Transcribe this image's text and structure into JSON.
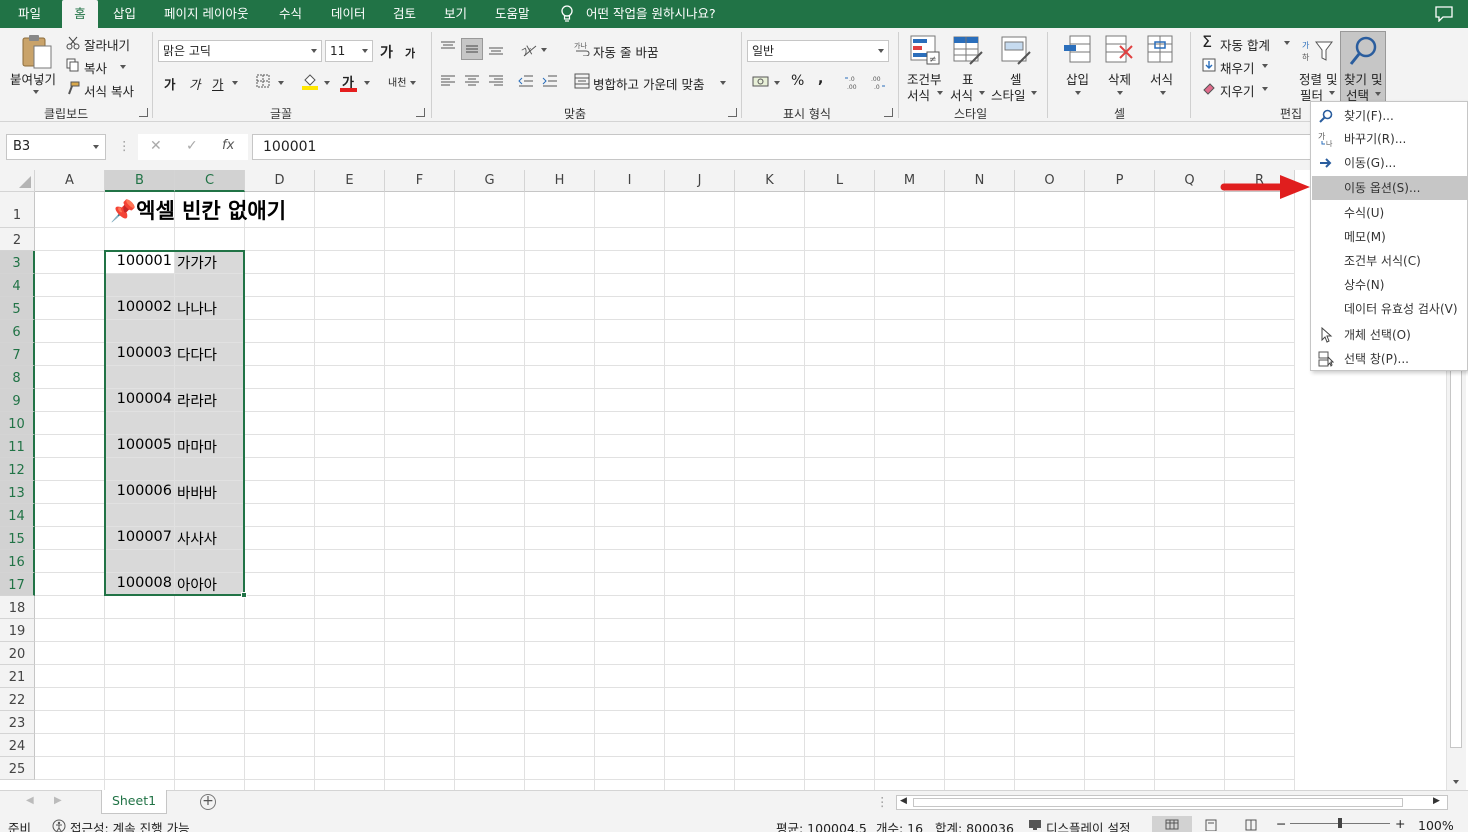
{
  "tabs": [
    "파일",
    "홈",
    "삽입",
    "페이지 레이아웃",
    "수식",
    "데이터",
    "검토",
    "보기",
    "도움말"
  ],
  "tell_me": "어떤 작업을 원하시나요?",
  "ribbon": {
    "clipboard": {
      "paste": "붙여넣기",
      "cut": "잘라내기",
      "copy": "복사",
      "format_painter": "서식 복사",
      "label": "클립보드"
    },
    "font": {
      "name": "맑은 고딕",
      "size": "11",
      "grow": "가",
      "shrink": "가",
      "bold": "가",
      "italic": "가",
      "underline": "가",
      "font_color": "가",
      "phonetic": "내천",
      "label": "글꼴"
    },
    "alignment": {
      "wrap": "자동 줄 바꿈",
      "merge": "병합하고 가운데 맞춤",
      "label": "맞춤"
    },
    "number": {
      "format": "일반",
      "percent": "%",
      "comma": ",",
      "inc": "←.0 .00",
      "dec": ".00 →.0",
      "label": "표시 형식"
    },
    "styles": {
      "conditional_1": "조건부",
      "conditional_2": "서식",
      "table_1": "표",
      "table_2": "서식",
      "cell_1": "셀",
      "cell_2": "스타일",
      "label": "스타일"
    },
    "cells": {
      "insert": "삽입",
      "delete": "삭제",
      "format": "서식",
      "label": "셀"
    },
    "editing": {
      "autosum": "자동 합계",
      "fill": "채우기",
      "clear": "지우기",
      "sort_1": "정렬 및",
      "sort_2": "필터",
      "find_1": "찾기 및",
      "find_2": "선택",
      "label": "편집"
    }
  },
  "formula_bar": {
    "name_box": "B3",
    "cancel": "✕",
    "enter": "✓",
    "fx": "fx",
    "value": "100001"
  },
  "columns": [
    "A",
    "B",
    "C",
    "D",
    "E",
    "F",
    "G",
    "H",
    "I",
    "J",
    "K",
    "L",
    "M",
    "N",
    "O",
    "P",
    "Q",
    "R"
  ],
  "rows": [
    "1",
    "2",
    "3",
    "4",
    "5",
    "6",
    "7",
    "8",
    "9",
    "10",
    "11",
    "12",
    "13",
    "14",
    "15",
    "16",
    "17",
    "18",
    "19",
    "20",
    "21",
    "22",
    "23",
    "24",
    "25"
  ],
  "sheet": {
    "title": "📌엑셀 빈칸 없애기",
    "data": [
      {
        "row": "3",
        "num": "100001",
        "text": "가가가"
      },
      {
        "row": "5",
        "num": "100002",
        "text": "나나나"
      },
      {
        "row": "7",
        "num": "100003",
        "text": "다다다"
      },
      {
        "row": "9",
        "num": "100004",
        "text": "라라라"
      },
      {
        "row": "11",
        "num": "100005",
        "text": "마마마"
      },
      {
        "row": "13",
        "num": "100006",
        "text": "바바바"
      },
      {
        "row": "15",
        "num": "100007",
        "text": "사사사"
      },
      {
        "row": "17",
        "num": "100008",
        "text": "아아아"
      }
    ]
  },
  "menu": {
    "items": [
      {
        "label": "찾기(F)...",
        "icon": "search-icon"
      },
      {
        "label": "바꾸기(R)...",
        "icon": "replace-icon"
      },
      {
        "label": "이동(G)...",
        "icon": "arrow-right-icon"
      },
      {
        "label": "이동 옵션(S)...",
        "icon": ""
      },
      {
        "label": "수식(U)",
        "icon": ""
      },
      {
        "label": "메모(M)",
        "icon": ""
      },
      {
        "label": "조건부 서식(C)",
        "icon": ""
      },
      {
        "label": "상수(N)",
        "icon": ""
      },
      {
        "label": "데이터 유효성 검사(V)",
        "icon": ""
      },
      {
        "label": "개체 선택(O)",
        "icon": "cursor-icon"
      },
      {
        "label": "선택 창(P)...",
        "icon": "selection-pane-icon"
      }
    ],
    "highlighted_index": 3
  },
  "sheet_tab": "Sheet1",
  "status": {
    "ready": "준비",
    "accessibility": "접근성: 계속 진행 가능",
    "average": "평균: 100004.5",
    "count": "개수: 16",
    "sum": "합계: 800036",
    "display": "디스플레이 설정",
    "zoom": "100%"
  },
  "colors": {
    "excel_green": "#217346",
    "arrow_red": "#e01e1e",
    "selection_gray": "#d9d9d9"
  }
}
